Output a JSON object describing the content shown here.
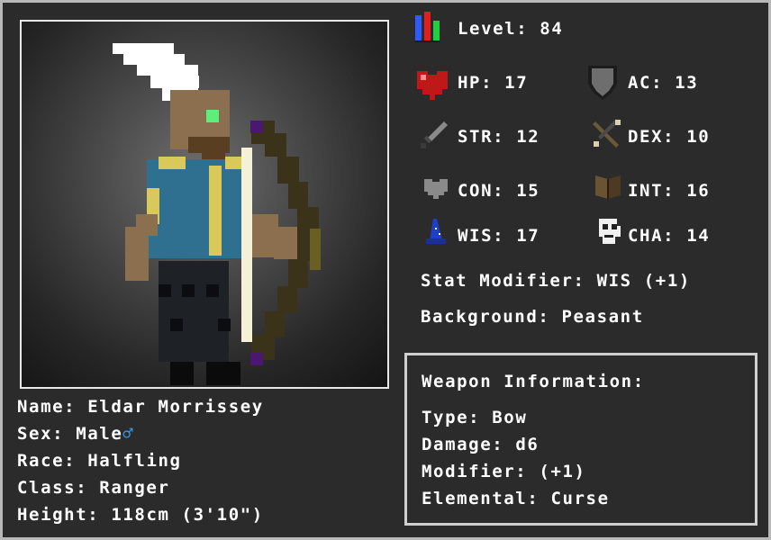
{
  "character": {
    "name_label": "Name:",
    "name": "Eldar Morrissey",
    "sex_label": "Sex:",
    "sex": "Male",
    "sex_symbol": "♂",
    "race_label": "Race:",
    "race": "Halfling",
    "class_label": "Class:",
    "class": "Ranger",
    "height_label": "Height:",
    "height": "118cm (3'10\")"
  },
  "stats": {
    "level_label": "Level:",
    "level": "84",
    "hp_label": "HP:",
    "hp": "17",
    "ac_label": "AC:",
    "ac": "13",
    "str_label": "STR:",
    "str": "12",
    "dex_label": "DEX:",
    "dex": "10",
    "con_label": "CON:",
    "con": "15",
    "int_label": "INT:",
    "int": "16",
    "wis_label": "WIS:",
    "wis": "17",
    "cha_label": "CHA:",
    "cha": "14",
    "modifier_label": "Stat Modifier:",
    "modifier": "WIS (+1)",
    "background_label": "Background:",
    "background": "Peasant"
  },
  "weapon": {
    "title": "Weapon Information:",
    "type_label": "Type:",
    "type": "Bow",
    "damage_label": "Damage:",
    "damage": "d6",
    "modifier_label": "Modifier:",
    "modifier": "(+1)",
    "elemental_label": "Elemental:",
    "elemental": "Curse"
  },
  "icons": {
    "level": "level-bars-icon",
    "hp": "heart-icon",
    "ac": "shield-icon",
    "str": "sword-icon",
    "dex": "crossbow-icon",
    "con": "gray-heart-icon",
    "int": "book-icon",
    "wis": "wizard-hat-icon",
    "cha": "mask-icon"
  },
  "colors": {
    "background": "#2b2b2b",
    "border": "#b9b9b9",
    "text": "#ffffff",
    "male_symbol": "#3a9be8",
    "tunic": "#2f6f8f",
    "trim": "#d9c95a"
  }
}
